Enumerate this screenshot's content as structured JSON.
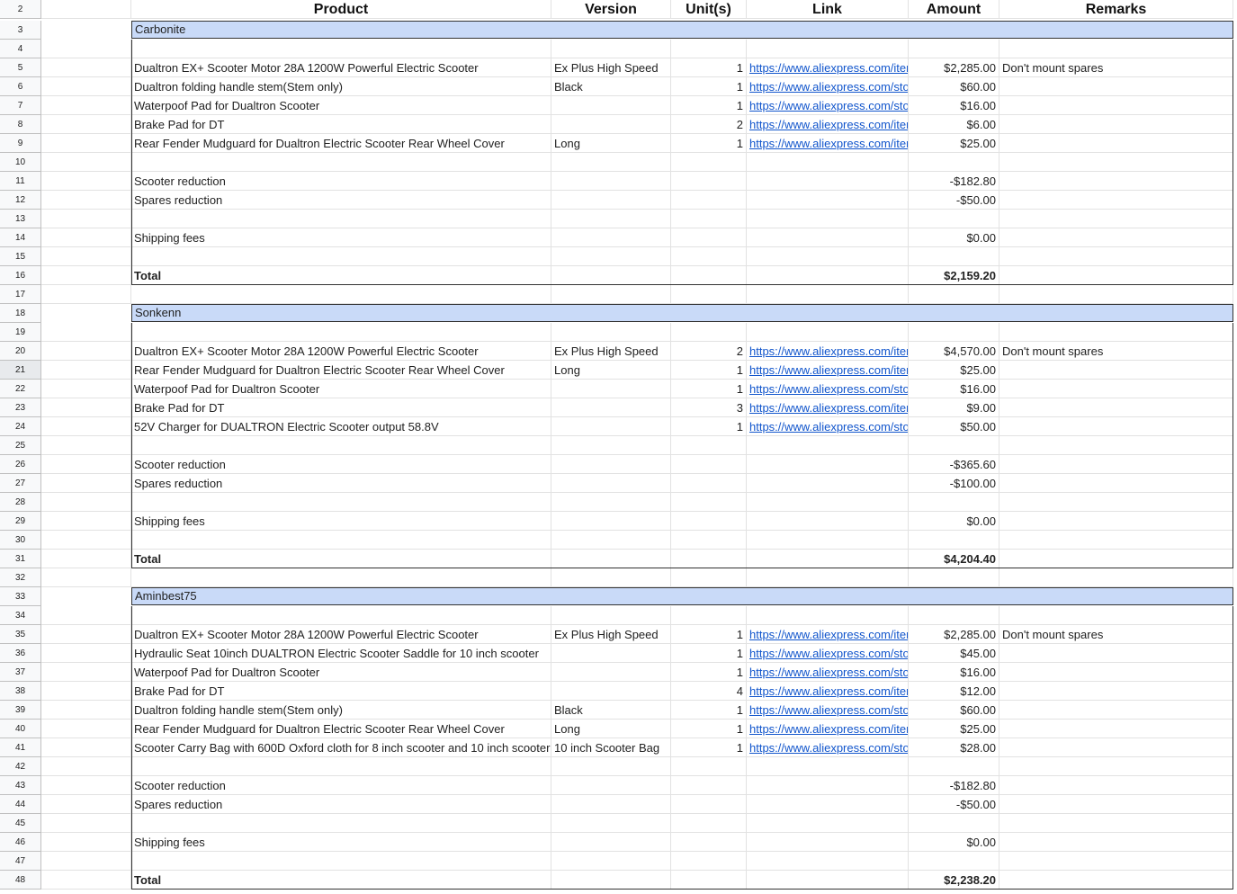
{
  "headers": {
    "product": "Product",
    "version": "Version",
    "units": "Unit(s)",
    "link": "Link",
    "amount": "Amount",
    "remarks": "Remarks"
  },
  "selected_row": "21",
  "colors": {
    "section_fill": "#c9daf8",
    "link": "#1155cc"
  },
  "sections": [
    {
      "name": "Carbonite",
      "name_row": "3",
      "blank_row_after_name": "4",
      "items": [
        {
          "row": "5",
          "product": "Dualtron EX+ Scooter Motor 28A 1200W Powerful Electric Scooter",
          "version": "Ex Plus High Speed",
          "units": "1",
          "link": "https://www.aliexpress.com/item/",
          "amount": "$2,285.00",
          "remarks": "Don't mount spares"
        },
        {
          "row": "6",
          "product": "Dualtron folding handle stem(Stem only)",
          "version": "Black",
          "units": "1",
          "link": "https://www.aliexpress.com/store/",
          "amount": "$60.00",
          "remarks": ""
        },
        {
          "row": "7",
          "product": "Waterpoof Pad for Dualtron Scooter",
          "version": "",
          "units": "1",
          "link": "https://www.aliexpress.com/store/",
          "amount": "$16.00",
          "remarks": ""
        },
        {
          "row": "8",
          "product": "Brake Pad for DT",
          "version": "",
          "units": "2",
          "link": "https://www.aliexpress.com/item/",
          "amount": "$6.00",
          "remarks": ""
        },
        {
          "row": "9",
          "product": "Rear Fender Mudguard for Dualtron Electric Scooter Rear Wheel Cover",
          "version": "Long",
          "units": "1",
          "link": "https://www.aliexpress.com/item/",
          "amount": "$25.00",
          "remarks": ""
        }
      ],
      "blank_after_items": "10",
      "scooter_reduction": {
        "row": "11",
        "label": "Scooter reduction",
        "amount": "-$182.80"
      },
      "spares_reduction": {
        "row": "12",
        "label": "Spares reduction",
        "amount": "-$50.00"
      },
      "blank_after_reductions": "13",
      "shipping": {
        "row": "14",
        "label": "Shipping fees",
        "amount": "$0.00"
      },
      "blank_before_total": "15",
      "total": {
        "row": "16",
        "label": "Total",
        "amount": "$2,159.20"
      },
      "blank_after_total": "17"
    },
    {
      "name": "Sonkenn",
      "name_row": "18",
      "blank_row_after_name": "19",
      "items": [
        {
          "row": "20",
          "product": "Dualtron EX+ Scooter Motor 28A 1200W Powerful Electric Scooter",
          "version": "Ex Plus High Speed",
          "units": "2",
          "link": "https://www.aliexpress.com/item/",
          "amount": "$4,570.00",
          "remarks": "Don't mount spares"
        },
        {
          "row": "21",
          "product": "Rear Fender Mudguard for Dualtron Electric Scooter Rear Wheel Cover",
          "version": "Long",
          "units": "1",
          "link": "https://www.aliexpress.com/item/",
          "amount": "$25.00",
          "remarks": ""
        },
        {
          "row": "22",
          "product": "Waterpoof Pad for Dualtron Scooter",
          "version": "",
          "units": "1",
          "link": "https://www.aliexpress.com/store/",
          "amount": "$16.00",
          "remarks": ""
        },
        {
          "row": "23",
          "product": "Brake Pad for DT",
          "version": "",
          "units": "3",
          "link": "https://www.aliexpress.com/item/",
          "amount": "$9.00",
          "remarks": ""
        },
        {
          "row": "24",
          "product": "52V Charger for DUALTRON Electric Scooter output 58.8V",
          "version": "",
          "units": "1",
          "link": "https://www.aliexpress.com/store/",
          "amount": "$50.00",
          "remarks": ""
        }
      ],
      "blank_after_items": "25",
      "scooter_reduction": {
        "row": "26",
        "label": "Scooter reduction",
        "amount": "-$365.60"
      },
      "spares_reduction": {
        "row": "27",
        "label": "Spares reduction",
        "amount": "-$100.00"
      },
      "blank_after_reductions": "28",
      "shipping": {
        "row": "29",
        "label": "Shipping fees",
        "amount": "$0.00"
      },
      "blank_before_total": "30",
      "total": {
        "row": "31",
        "label": "Total",
        "amount": "$4,204.40"
      },
      "blank_after_total": "32"
    },
    {
      "name": "Aminbest75",
      "name_row": "33",
      "blank_row_after_name": "34",
      "items": [
        {
          "row": "35",
          "product": "Dualtron EX+ Scooter Motor 28A 1200W Powerful Electric Scooter",
          "version": "Ex Plus High Speed",
          "units": "1",
          "link": "https://www.aliexpress.com/item/",
          "amount": "$2,285.00",
          "remarks": "Don't mount spares"
        },
        {
          "row": "36",
          "product": "Hydraulic Seat 10inch DUALTRON Electric Scooter Saddle for 10 inch scooter",
          "version": "",
          "units": "1",
          "link": "https://www.aliexpress.com/store/",
          "amount": "$45.00",
          "remarks": ""
        },
        {
          "row": "37",
          "product": "Waterpoof Pad for Dualtron Scooter",
          "version": "",
          "units": "1",
          "link": "https://www.aliexpress.com/store/",
          "amount": "$16.00",
          "remarks": ""
        },
        {
          "row": "38",
          "product": "Brake Pad for DT",
          "version": "",
          "units": "4",
          "link": "https://www.aliexpress.com/item/",
          "amount": "$12.00",
          "remarks": ""
        },
        {
          "row": "39",
          "product": "Dualtron folding handle stem(Stem only)",
          "version": "Black",
          "units": "1",
          "link": "https://www.aliexpress.com/store/",
          "amount": "$60.00",
          "remarks": ""
        },
        {
          "row": "40",
          "product": "Rear Fender Mudguard for Dualtron Electric Scooter Rear Wheel Cover",
          "version": "Long",
          "units": "1",
          "link": "https://www.aliexpress.com/item/",
          "amount": "$25.00",
          "remarks": ""
        },
        {
          "row": "41",
          "product": "Scooter Carry Bag with 600D Oxford cloth for 8 inch scooter and 10 inch scooter",
          "version": "10 inch Scooter Bag",
          "units": "1",
          "link": "https://www.aliexpress.com/store/",
          "amount": "$28.00",
          "remarks": ""
        }
      ],
      "blank_after_items": "42",
      "scooter_reduction": {
        "row": "43",
        "label": "Scooter reduction",
        "amount": "-$182.80"
      },
      "spares_reduction": {
        "row": "44",
        "label": "Spares reduction",
        "amount": "-$50.00"
      },
      "blank_after_reductions": "45",
      "shipping": {
        "row": "46",
        "label": "Shipping fees",
        "amount": "$0.00"
      },
      "blank_before_total": "47",
      "total": {
        "row": "48",
        "label": "Total",
        "amount": "$2,238.20"
      }
    }
  ],
  "header_row": "2"
}
